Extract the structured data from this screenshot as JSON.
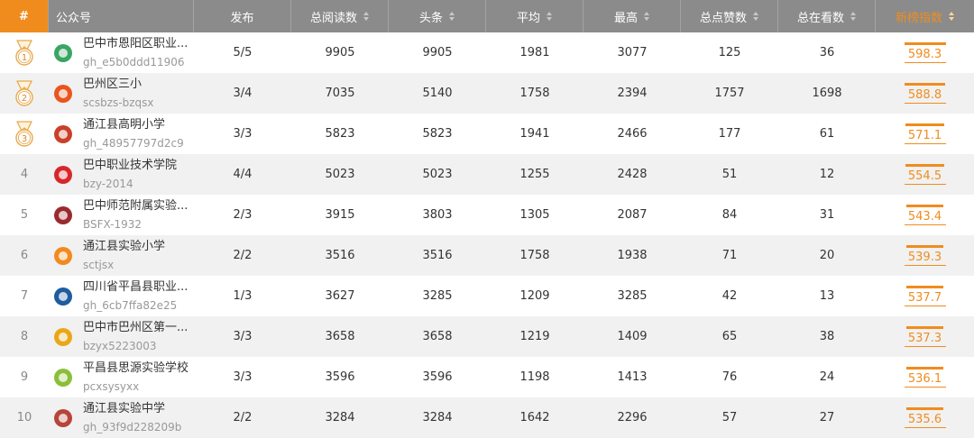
{
  "header": {
    "rank": "#",
    "account": "公众号",
    "published": "发布",
    "total_reads": "总阅读数",
    "headline": "头条",
    "average": "平均",
    "highest": "最高",
    "total_likes": "总点赞数",
    "total_viewing": "总在看数",
    "new_rank_index": "新榜指数"
  },
  "colors": {
    "accent": "#f08c1e",
    "header_bg": "#8b8b8b",
    "stripe": "#f1f1f1"
  },
  "rows": [
    {
      "rank": "1",
      "medal": true,
      "avatar_color": "#3aa563",
      "name": "巴中市恩阳区职业...",
      "id": "gh_e5b0ddd11906",
      "published": "5/5",
      "total_reads": "9905",
      "headline": "9905",
      "average": "1981",
      "highest": "3077",
      "likes": "125",
      "viewing": "36",
      "index": "598.3",
      "index_fraction": 1.0
    },
    {
      "rank": "2",
      "medal": true,
      "avatar_color": "#e8551e",
      "name": "巴州区三小",
      "id": "scsbzs-bzqsx",
      "published": "3/4",
      "total_reads": "7035",
      "headline": "5140",
      "average": "1758",
      "highest": "2394",
      "likes": "1757",
      "viewing": "1698",
      "index": "588.8",
      "index_fraction": 0.98
    },
    {
      "rank": "3",
      "medal": true,
      "avatar_color": "#c9402a",
      "name": "通江县高明小学",
      "id": "gh_48957797d2c9",
      "published": "3/3",
      "total_reads": "5823",
      "headline": "5823",
      "average": "1941",
      "highest": "2466",
      "likes": "177",
      "viewing": "61",
      "index": "571.1",
      "index_fraction": 0.95
    },
    {
      "rank": "4",
      "medal": false,
      "avatar_color": "#d8262b",
      "name": "巴中职业技术学院",
      "id": "bzy-2014",
      "published": "4/4",
      "total_reads": "5023",
      "headline": "5023",
      "average": "1255",
      "highest": "2428",
      "likes": "51",
      "viewing": "12",
      "index": "554.5",
      "index_fraction": 0.93
    },
    {
      "rank": "5",
      "medal": false,
      "avatar_color": "#9b2a2e",
      "name": "巴中师范附属实验...",
      "id": "BSFX-1932",
      "published": "2/3",
      "total_reads": "3915",
      "headline": "3803",
      "average": "1305",
      "highest": "2087",
      "likes": "84",
      "viewing": "31",
      "index": "543.4",
      "index_fraction": 0.91
    },
    {
      "rank": "6",
      "medal": false,
      "avatar_color": "#f28a1e",
      "name": "通江县实验小学",
      "id": "sctjsx",
      "published": "2/2",
      "total_reads": "3516",
      "headline": "3516",
      "average": "1758",
      "highest": "1938",
      "likes": "71",
      "viewing": "20",
      "index": "539.3",
      "index_fraction": 0.9
    },
    {
      "rank": "7",
      "medal": false,
      "avatar_color": "#1f5c9e",
      "name": "四川省平昌县职业...",
      "id": "gh_6cb7ffa82e25",
      "published": "1/3",
      "total_reads": "3627",
      "headline": "3285",
      "average": "1209",
      "highest": "3285",
      "likes": "42",
      "viewing": "13",
      "index": "537.7",
      "index_fraction": 0.9
    },
    {
      "rank": "8",
      "medal": false,
      "avatar_color": "#e9a71a",
      "name": "巴中市巴州区第一...",
      "id": "bzyx5223003",
      "published": "3/3",
      "total_reads": "3658",
      "headline": "3658",
      "average": "1219",
      "highest": "1409",
      "likes": "65",
      "viewing": "38",
      "index": "537.3",
      "index_fraction": 0.9
    },
    {
      "rank": "9",
      "medal": false,
      "avatar_color": "#8bbf3a",
      "name": "平昌县思源实验学校",
      "id": "pcxsysyxx",
      "published": "3/3",
      "total_reads": "3596",
      "headline": "3596",
      "average": "1198",
      "highest": "1413",
      "likes": "76",
      "viewing": "24",
      "index": "536.1",
      "index_fraction": 0.9
    },
    {
      "rank": "10",
      "medal": false,
      "avatar_color": "#b6443a",
      "name": "通江县实验中学",
      "id": "gh_93f9d228209b",
      "published": "2/2",
      "total_reads": "3284",
      "headline": "3284",
      "average": "1642",
      "highest": "2296",
      "likes": "57",
      "viewing": "27",
      "index": "535.6",
      "index_fraction": 0.9
    }
  ]
}
